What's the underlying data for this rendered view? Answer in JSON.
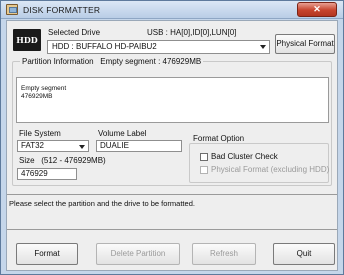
{
  "window": {
    "title": "DISK FORMATTER",
    "close_label": "✕"
  },
  "header": {
    "logo_text": "HDD",
    "drive_label": "Selected Drive",
    "usb_label": "USB : HA[0],ID[0],LUN[0]",
    "drive_value": "HDD : BUFFALO HD-PAIBU2",
    "physical_format_button": "Physical Format"
  },
  "partition": {
    "title": "Partition Information",
    "summary": "Empty segment : 476929MB",
    "list_line1": "Empty segment",
    "list_line2": "476929MB"
  },
  "fields": {
    "file_system_label": "File System",
    "file_system_value": "FAT32",
    "volume_label_label": "Volume Label",
    "volume_label_value": "DUALIE",
    "size_label": "Size",
    "size_range": "(512 - 476929MB)",
    "size_value": "476929"
  },
  "format_option": {
    "title": "Format Option",
    "bad_cluster_label": "Bad Cluster Check",
    "physical_format_label": "Physical Format (excluding HDD)",
    "bad_cluster_checked": false,
    "physical_format_checked": false
  },
  "status": {
    "message": "Please select the partition and the drive to be formatted."
  },
  "buttons": {
    "format": "Format",
    "delete_partition": "Delete Partition",
    "refresh": "Refresh",
    "quit": "Quit"
  },
  "colors": {
    "title_bar": "#c5d6ea",
    "close_button": "#c7442d",
    "client_bg": "#eeeeee"
  }
}
